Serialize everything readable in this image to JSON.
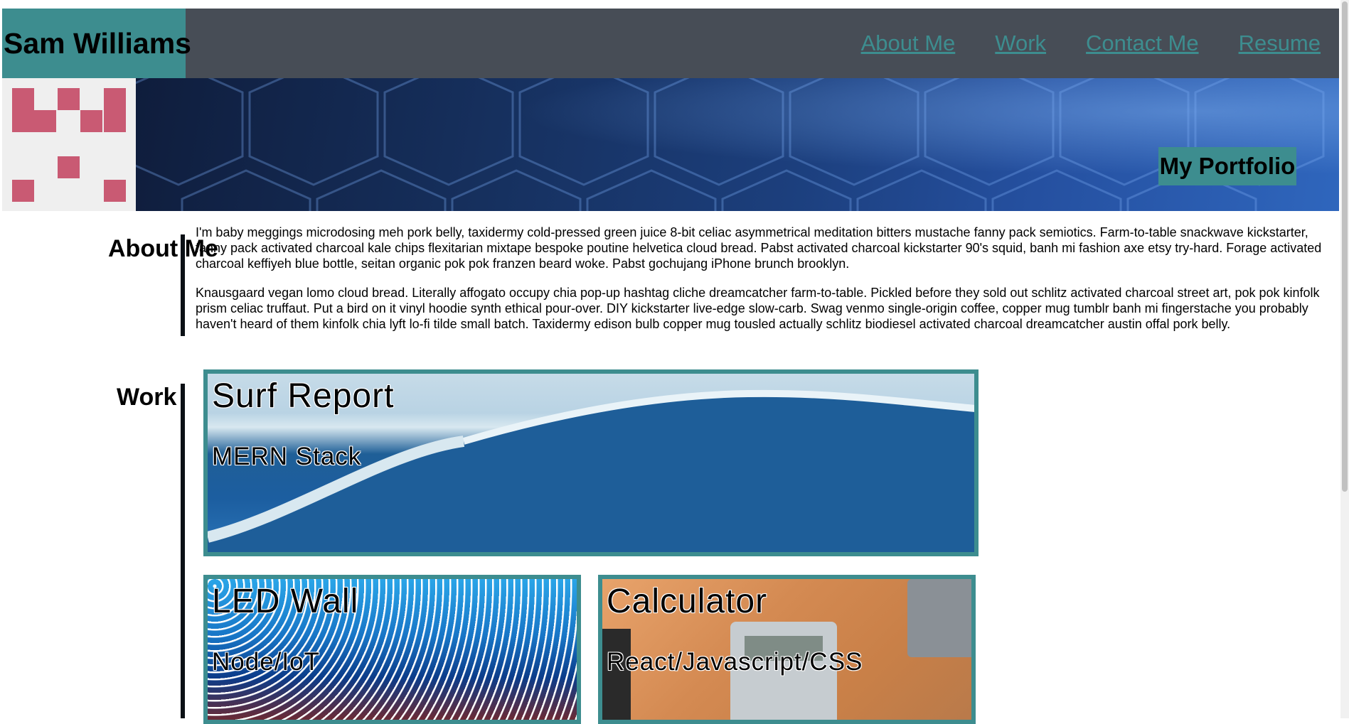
{
  "header": {
    "brand": "Sam Williams",
    "nav": [
      "About Me",
      "Work",
      "Contact Me",
      "Resume"
    ]
  },
  "hero": {
    "tag": "My Portfolio"
  },
  "about": {
    "heading": "About Me",
    "paragraphs": [
      "I'm baby meggings microdosing meh pork belly, taxidermy cold-pressed green juice 8-bit celiac asymmetrical meditation bitters mustache fanny pack semiotics. Farm-to-table snackwave kickstarter, fanny pack activated charcoal kale chips flexitarian mixtape bespoke poutine helvetica cloud bread. Pabst activated charcoal kickstarter 90's squid, banh mi fashion axe etsy try-hard. Forage activated charcoal keffiyeh blue bottle, seitan organic pok pok franzen beard woke. Pabst gochujang iPhone brunch brooklyn.",
      "Knausgaard vegan lomo cloud bread. Literally affogato occupy chia pop-up hashtag cliche dreamcatcher farm-to-table. Pickled before they sold out schlitz activated charcoal street art, pok pok kinfolk prism celiac truffaut. Put a bird on it vinyl hoodie synth ethical pour-over. DIY kickstarter live-edge slow-carb. Swag venmo single-origin coffee, copper mug tumblr banh mi fingerstache you probably haven't heard of them kinfolk chia lyft lo-fi tilde small batch. Taxidermy edison bulb copper mug tousled actually schlitz biodiesel activated charcoal dreamcatcher austin offal pork belly."
    ]
  },
  "work": {
    "heading": "Work",
    "projects": [
      {
        "title": "Surf Report",
        "stack": "MERN Stack"
      },
      {
        "title": "LED Wall",
        "stack": "Node/IoT"
      },
      {
        "title": "Calculator",
        "stack": "React/Javascript/CSS"
      }
    ]
  },
  "colors": {
    "accent": "#3d8d8f",
    "header_bg": "#474d56",
    "avatar_pixel": "#c95a73"
  },
  "icons": {
    "avatar": "pixel-identicon"
  }
}
